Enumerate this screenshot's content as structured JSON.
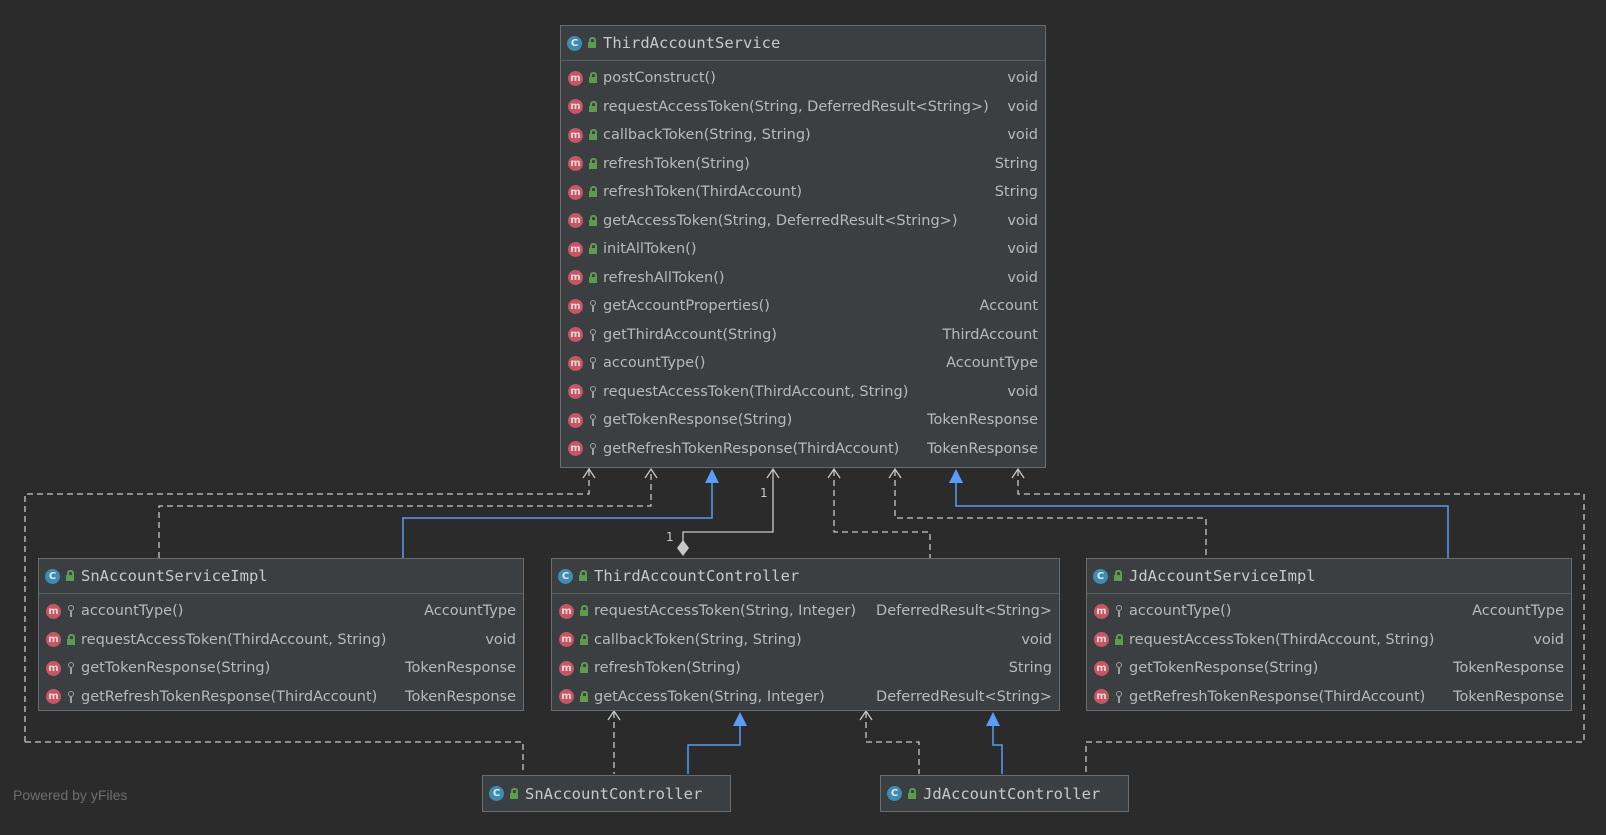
{
  "diagram": {
    "classes": {
      "third_account_service": {
        "name": "ThirdAccountService",
        "kind_icon": "abstract-class-icon",
        "visibility_icon": "public-icon",
        "methods": [
          {
            "name": "postConstruct()",
            "type": "void",
            "visibility": "public"
          },
          {
            "name": "requestAccessToken(String, DeferredResult<String>)",
            "type": "void",
            "visibility": "public"
          },
          {
            "name": "callbackToken(String, String)",
            "type": "void",
            "visibility": "public"
          },
          {
            "name": "refreshToken(String)",
            "type": "String",
            "visibility": "public"
          },
          {
            "name": "refreshToken(ThirdAccount)",
            "type": "String",
            "visibility": "public"
          },
          {
            "name": "getAccessToken(String, DeferredResult<String>)",
            "type": "void",
            "visibility": "public"
          },
          {
            "name": "initAllToken()",
            "type": "void",
            "visibility": "public"
          },
          {
            "name": "refreshAllToken()",
            "type": "void",
            "visibility": "public"
          },
          {
            "name": "getAccountProperties()",
            "type": "Account",
            "visibility": "protected"
          },
          {
            "name": "getThirdAccount(String)",
            "type": "ThirdAccount",
            "visibility": "protected"
          },
          {
            "name": "accountType()",
            "type": "AccountType",
            "visibility": "protected"
          },
          {
            "name": "requestAccessToken(ThirdAccount, String)",
            "type": "void",
            "visibility": "protected"
          },
          {
            "name": "getTokenResponse(String)",
            "type": "TokenResponse",
            "visibility": "protected"
          },
          {
            "name": "getRefreshTokenResponse(ThirdAccount)",
            "type": "TokenResponse",
            "visibility": "protected"
          }
        ]
      },
      "sn_account_service_impl": {
        "name": "SnAccountServiceImpl",
        "kind_icon": "class-icon",
        "visibility_icon": "public-icon",
        "methods": [
          {
            "name": "accountType()",
            "type": "AccountType",
            "visibility": "protected"
          },
          {
            "name": "requestAccessToken(ThirdAccount, String)",
            "type": "void",
            "visibility": "public"
          },
          {
            "name": "getTokenResponse(String)",
            "type": "TokenResponse",
            "visibility": "protected"
          },
          {
            "name": "getRefreshTokenResponse(ThirdAccount)",
            "type": "TokenResponse",
            "visibility": "protected"
          }
        ]
      },
      "third_account_controller": {
        "name": "ThirdAccountController",
        "kind_icon": "class-icon",
        "visibility_icon": "public-icon",
        "methods": [
          {
            "name": "requestAccessToken(String, Integer)",
            "type": "DeferredResult<String>",
            "visibility": "public"
          },
          {
            "name": "callbackToken(String, String)",
            "type": "void",
            "visibility": "public"
          },
          {
            "name": "refreshToken(String)",
            "type": "String",
            "visibility": "public"
          },
          {
            "name": "getAccessToken(String, Integer)",
            "type": "DeferredResult<String>",
            "visibility": "public"
          }
        ]
      },
      "jd_account_service_impl": {
        "name": "JdAccountServiceImpl",
        "kind_icon": "class-icon",
        "visibility_icon": "public-icon",
        "methods": [
          {
            "name": "accountType()",
            "type": "AccountType",
            "visibility": "protected"
          },
          {
            "name": "requestAccessToken(ThirdAccount, String)",
            "type": "void",
            "visibility": "public"
          },
          {
            "name": "getTokenResponse(String)",
            "type": "TokenResponse",
            "visibility": "protected"
          },
          {
            "name": "getRefreshTokenResponse(ThirdAccount)",
            "type": "TokenResponse",
            "visibility": "protected"
          }
        ]
      },
      "sn_account_controller": {
        "name": "SnAccountController",
        "kind_icon": "class-icon",
        "visibility_icon": "public-icon",
        "methods": []
      },
      "jd_account_controller": {
        "name": "JdAccountController",
        "kind_icon": "class-icon",
        "visibility_icon": "public-icon",
        "methods": []
      }
    },
    "multiplicity": {
      "service_end": "1",
      "controller_end": "1"
    },
    "colors": {
      "background": "#2b2b2b",
      "box": "#3c3f41",
      "dependency_edge": "#c8c8c8",
      "inheritance_edge": "#589df6"
    }
  },
  "footer": {
    "watermark": "Powered by yFiles"
  }
}
